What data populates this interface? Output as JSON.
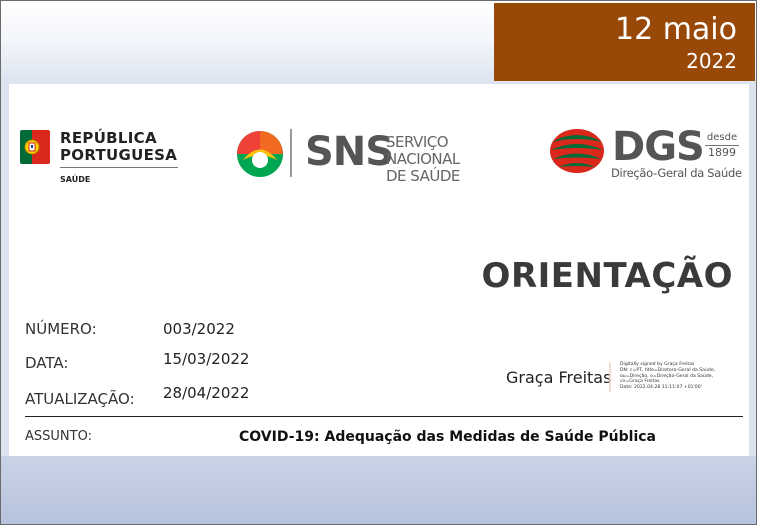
{
  "header": {
    "date_day": "12 maio",
    "date_year": "2022"
  },
  "logos": {
    "republica": {
      "line1": "REPÚBLICA",
      "line2": "PORTUGUESA",
      "sub": "SAÚDE"
    },
    "sns": {
      "acronym": "SNS",
      "line1": "SERVIÇO NACIONAL",
      "line2": "DE SAÚDE"
    },
    "dgs": {
      "acronym": "DGS",
      "desde": "desde",
      "year": "1899",
      "sub": "Direção-Geral da Saúde"
    }
  },
  "document": {
    "title": "ORIENTAÇÃO",
    "numero_label": "NÚMERO:",
    "numero_value": "003/2022",
    "data_label": "DATA:",
    "data_value": "15/03/2022",
    "atualizacao_label": "ATUALIZAÇÃO:",
    "atualizacao_value": "28/04/2022",
    "assunto_label": "ASSUNTO:",
    "assunto_value": "COVID-19: Adequação das Medidas de Saúde Pública"
  },
  "signature": {
    "name": "Graça Freitas",
    "details": "Digitally signed by Graça Freitas\nDN: c=PT, title=Diretora-Geral da Saúde,\nou=Direção, o=Direção-Geral da Saúde,\ncn=Graça Freitas\nDate: 2022.04.28 11:11:07 +01'00'"
  },
  "colors": {
    "date_box": "#984807",
    "text_dark": "#3a3a3a",
    "portugal_green": "#046a38",
    "portugal_red": "#da291c",
    "sns_yellow": "#ffc20e",
    "sns_orange": "#f26a21",
    "sns_green": "#00a651"
  }
}
